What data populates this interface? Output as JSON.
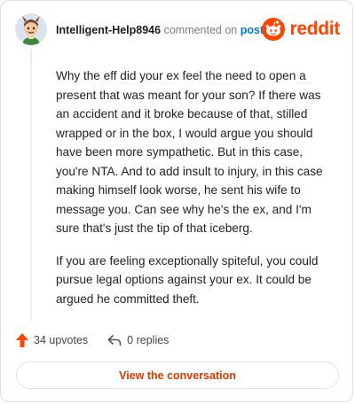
{
  "comment": {
    "username": "Intelligent-Help8946",
    "action_text": "commented on",
    "post_link": "post",
    "paragraphs": [
      "Why the eff did your ex feel the need to open a present that was meant for your son? If there was an accident and it broke because of that, stilled wrapped or in the box, I would argue you should have been more sympathetic. But in this case, you're NTA. And to add insult to injury, in this case making himself look worse, he sent his wife to message you. Can see why he's the ex, and I'm sure that's just the tip of that iceberg.",
      "If you are feeling exceptionally spiteful, you could pursue legal options against your ex. It could be argued he committed theft."
    ]
  },
  "logo": {
    "text": "reddit",
    "icon": "reddit-snoo-icon",
    "color": "#ff4500"
  },
  "actions": {
    "upvotes": "34 upvotes",
    "replies": "0 replies",
    "upvote_icon": "upvote-arrow-icon",
    "reply_icon": "reply-arrow-icon",
    "upvote_color": "#ff4500"
  },
  "view_button": {
    "label": "View the conversation",
    "color": "#d93a00"
  }
}
